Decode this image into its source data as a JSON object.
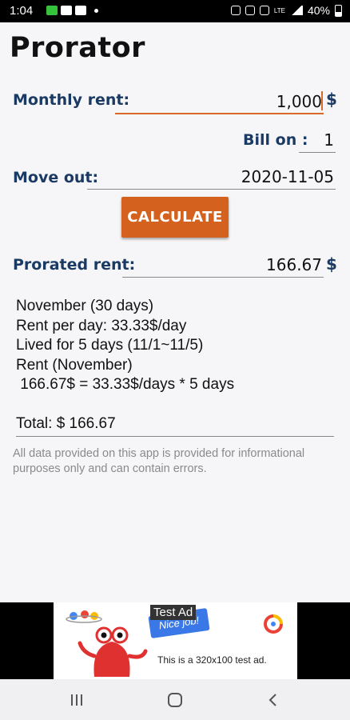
{
  "status_bar": {
    "time": "1:04",
    "battery": "40%",
    "network": "LTE"
  },
  "app": {
    "title": "Prorator"
  },
  "form": {
    "monthly_rent_label": "Monthly rent:",
    "monthly_rent_value": "1,000",
    "currency": "$",
    "bill_on_label": "Bill on :",
    "bill_on_value": "1",
    "move_out_label": "Move out:",
    "move_out_value": "2020-11-05",
    "calculate_label": "CALCULATE",
    "prorated_label": "Prorated rent:",
    "prorated_value": "166.67"
  },
  "details": {
    "lines": [
      "November (30 days)",
      "Rent per day: 33.33$/day",
      "Lived for 5 days (11/1~11/5)",
      "Rent (November)",
      " 166.67$ = 33.33$/days * 5 days"
    ],
    "total": "Total: $ 166.67"
  },
  "disclaimer": "All data provided on this app is provided for informational purposes only and can contain errors.",
  "ad": {
    "label": "Test Ad",
    "banner_text": "Nice job!",
    "text": "This is a 320x100 test ad."
  },
  "colors": {
    "accent": "#d4621e",
    "label": "#1b3a63",
    "active_underline": "#d86a2a"
  }
}
